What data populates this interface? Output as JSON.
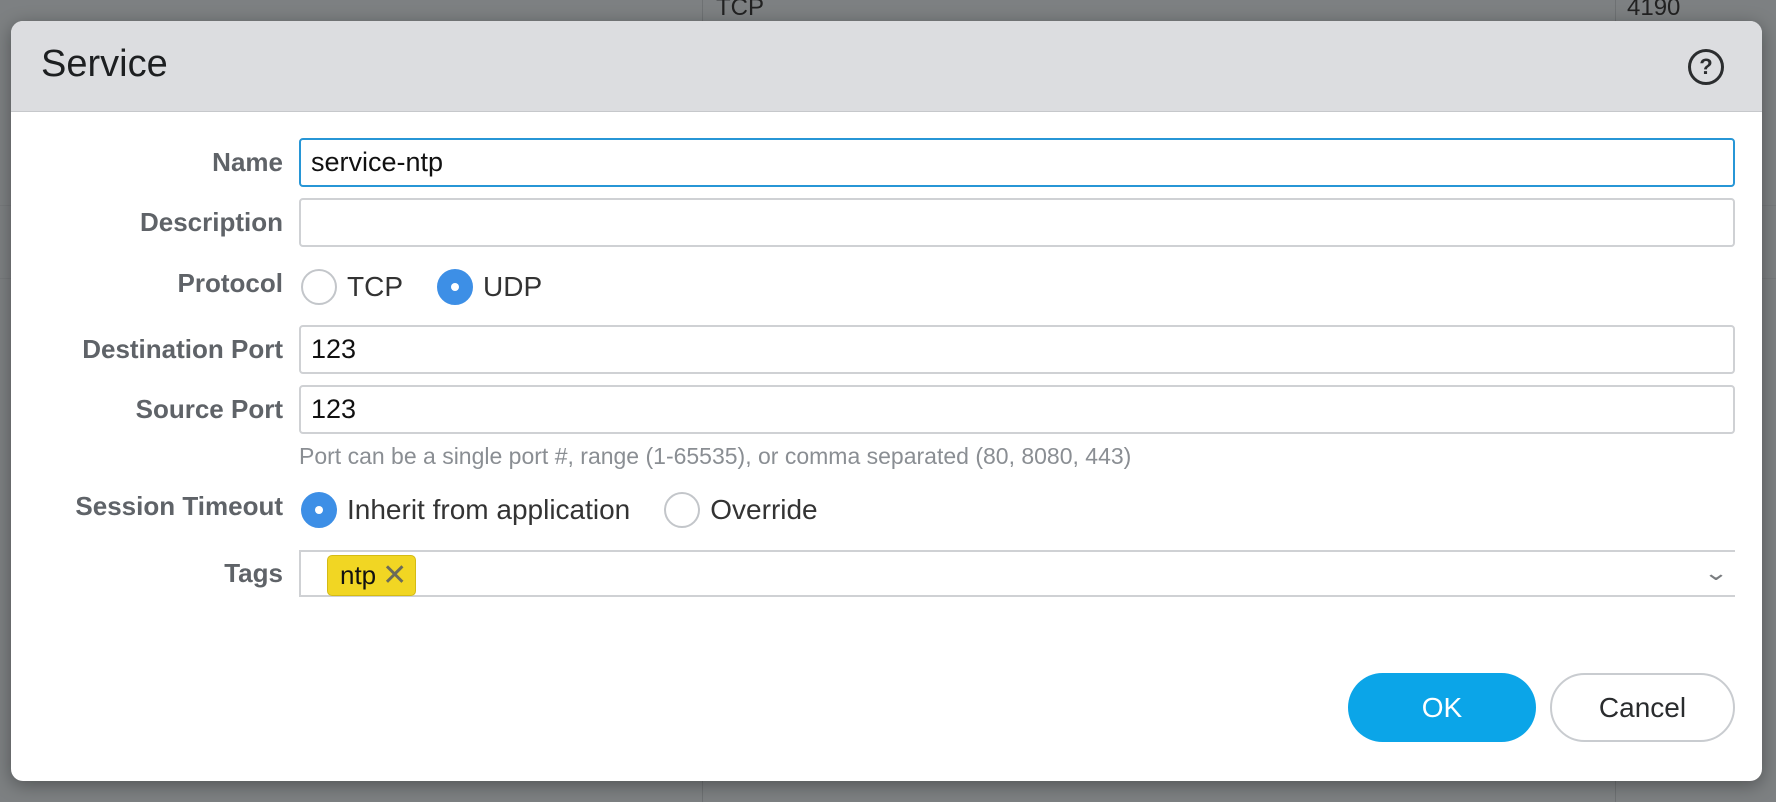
{
  "background": {
    "col1_text": "TCP",
    "col2_text": "4190"
  },
  "dialog": {
    "title": "Service",
    "help_icon": "help-circle-icon"
  },
  "form": {
    "name": {
      "label": "Name",
      "value": "service-ntp"
    },
    "description": {
      "label": "Description",
      "value": ""
    },
    "protocol": {
      "label": "Protocol",
      "options": [
        {
          "label": "TCP",
          "checked": false
        },
        {
          "label": "UDP",
          "checked": true
        }
      ]
    },
    "destination_port": {
      "label": "Destination Port",
      "value": "123"
    },
    "source_port": {
      "label": "Source Port",
      "value": "123"
    },
    "port_hint": "Port can be a single port #, range (1-65535), or comma separated (80, 8080, 443)",
    "session_timeout": {
      "label": "Session Timeout",
      "options": [
        {
          "label": "Inherit from application",
          "checked": true
        },
        {
          "label": "Override",
          "checked": false
        }
      ]
    },
    "tags": {
      "label": "Tags",
      "chips": [
        {
          "text": "ntp",
          "remove_glyph": "✕"
        }
      ],
      "dropdown_glyph": "⌄"
    }
  },
  "buttons": {
    "ok": "OK",
    "cancel": "Cancel"
  },
  "colors": {
    "accent": "#0ba5e8",
    "radio_checked": "#3d8fe6",
    "tag_chip": "#f1d623",
    "focus_border": "#2796d6"
  }
}
